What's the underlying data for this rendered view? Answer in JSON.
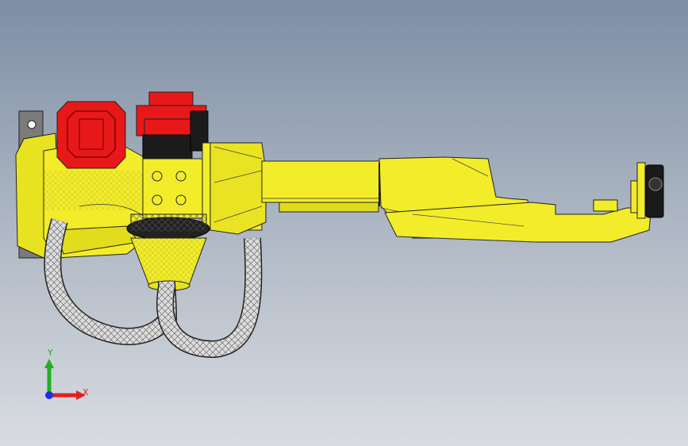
{
  "viewport": {
    "background_top": "#7d8ea5",
    "background_bottom": "#d9dce2"
  },
  "model": {
    "primary_color": "#f2ec2a",
    "accent_color": "#e81818",
    "cable_color": "#d8d8d8"
  },
  "triad": {
    "x_label": "X",
    "y_label": "Y",
    "x_color": "#e02020",
    "y_color": "#20b020",
    "z_color": "#2030e0"
  }
}
